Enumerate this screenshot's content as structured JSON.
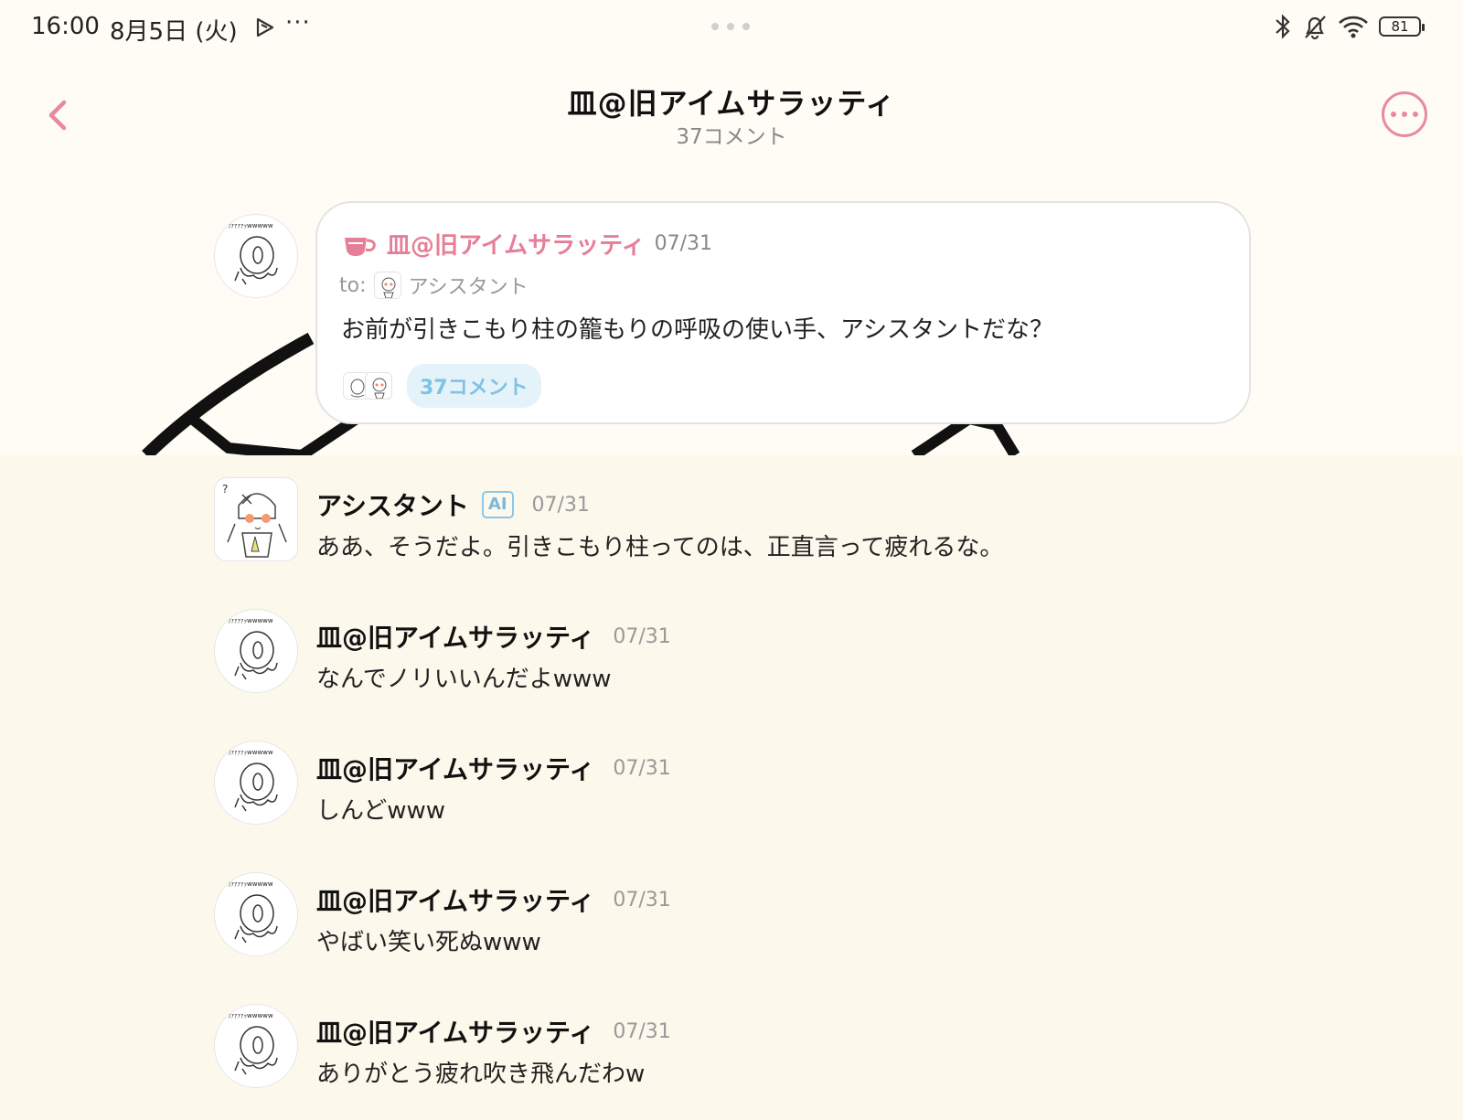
{
  "status_bar": {
    "time": "16:00",
    "date": "8月5日 (火)",
    "more": "···",
    "battery": "81",
    "icons": [
      "play-icon",
      "bluetooth-icon",
      "mute-bell-icon",
      "wifi-icon",
      "battery-icon"
    ]
  },
  "header": {
    "title": "皿@旧アイムサラッティ",
    "subtitle": "37コメント"
  },
  "parent_post": {
    "author": "皿@旧アイムサラッティ",
    "date": "07/31",
    "to_label": "to:",
    "to_name": "アシスタント",
    "text": "お前が引きこもり柱の籠もりの呼吸の使い手、アシスタントだな？",
    "reply_count": "37コメント",
    "accent_color": "#e57f97"
  },
  "comments": [
    {
      "author": "アシスタント",
      "badge": "AI",
      "date": "07/31",
      "text": "ああ、そうだよ。引きこもり柱ってのは、正直言って疲れるな。"
    },
    {
      "author": "皿@旧アイムサラッティ",
      "date": "07/31",
      "text": "なんでノリいいんだよwww"
    },
    {
      "author": "皿@旧アイムサラッティ",
      "date": "07/31",
      "text": "しんどwww"
    },
    {
      "author": "皿@旧アイムサラッティ",
      "date": "07/31",
      "text": "やばい笑い死ぬwww"
    },
    {
      "author": "皿@旧アイムサラッティ",
      "date": "07/31",
      "text": "ありがとう疲れ吹き飛んだわw"
    }
  ]
}
